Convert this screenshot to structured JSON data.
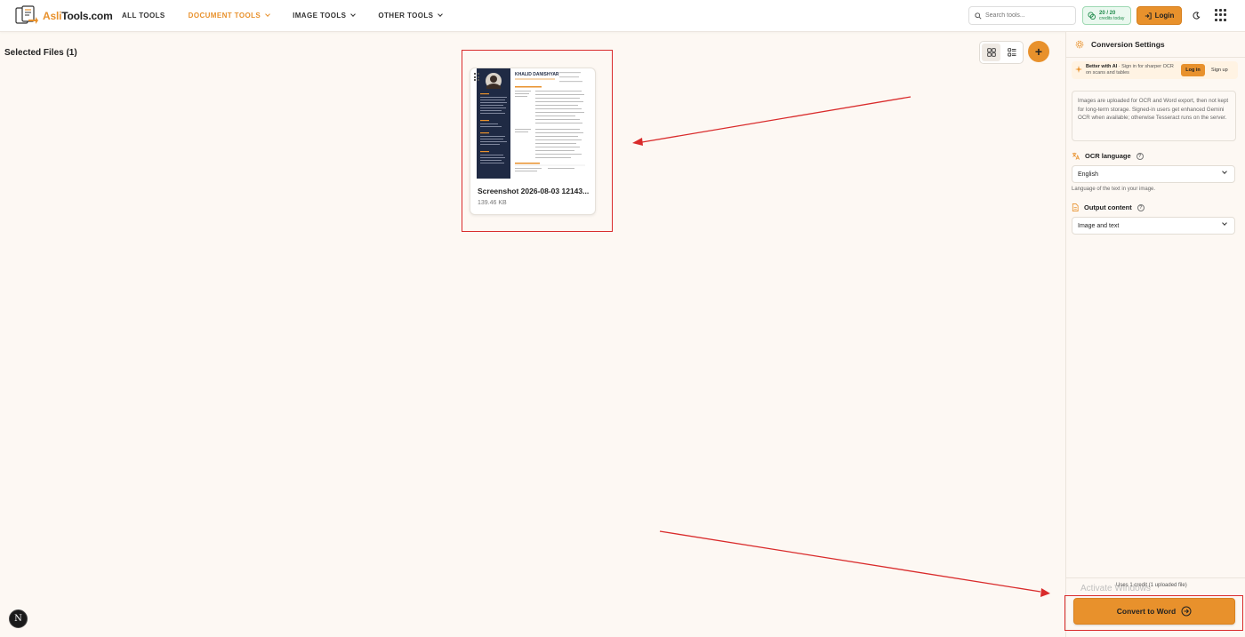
{
  "header": {
    "logo_text_a": "Asli",
    "logo_text_b": "Tools.com",
    "nav": [
      {
        "label": "ALL TOOLS",
        "active": false
      },
      {
        "label": "DOCUMENT TOOLS",
        "active": true
      },
      {
        "label": "IMAGE TOOLS",
        "active": false
      },
      {
        "label": "OTHER TOOLS",
        "active": false
      }
    ],
    "search_placeholder": "Search tools...",
    "credits_count": "20 / 20",
    "credits_label": "credits today",
    "login_label": "Login"
  },
  "main": {
    "selected_title": "Selected Files (1)",
    "file": {
      "name": "Screenshot 2026-08-03 12143...",
      "size": "139.46 KB",
      "thumb_name": "KHALID DANISHYAR"
    }
  },
  "sidebar": {
    "title": "Conversion Settings",
    "ai_bold": "Better with AI",
    "ai_text": " · Sign in for sharper OCR on scans and tables",
    "ai_login": "Log in",
    "ai_signup": "Sign up",
    "info": "Images are uploaded for OCR and Word export, then not kept for long-term storage. Signed-in users get enhanced Gemini OCR when available; otherwise Tesseract runs on the server.",
    "ocr_label": "OCR language",
    "ocr_value": "English",
    "ocr_hint": "Language of the text in your image.",
    "output_label": "Output content",
    "output_value": "Image and text",
    "used_text": "Uses 1 credit (1 uploaded file)",
    "watermark": "Activate Windows",
    "convert_label": "Convert to Word"
  },
  "misc": {
    "badge_letter": "N"
  },
  "colors": {
    "accent": "#e8912c",
    "background": "#fdf8f3",
    "annotation": "#d92b2b",
    "credits_green": "#1e8a4a"
  }
}
